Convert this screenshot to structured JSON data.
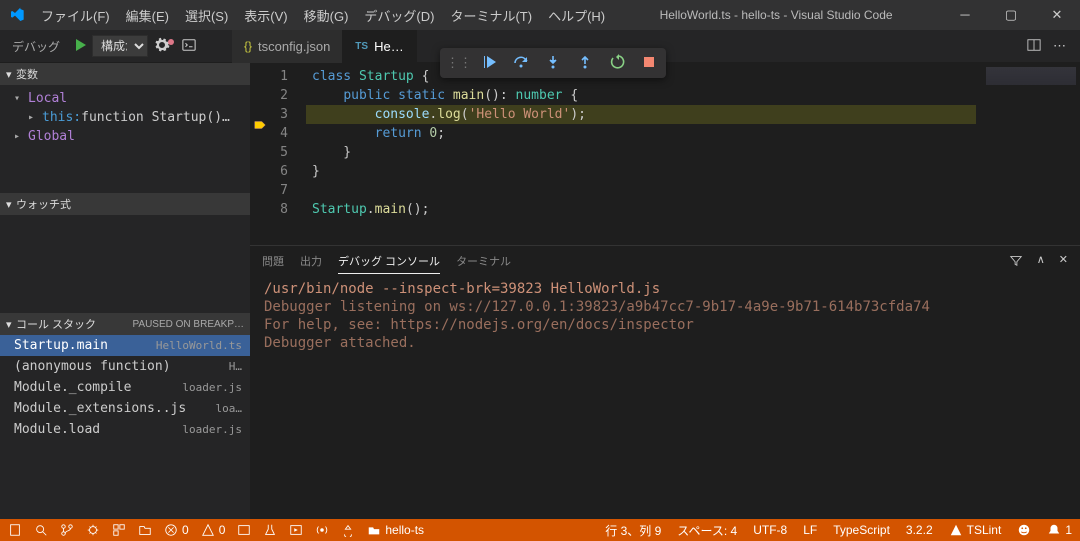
{
  "titlebar": {
    "menu": [
      "ファイル(F)",
      "編集(E)",
      "選択(S)",
      "表示(V)",
      "移動(G)",
      "デバッグ(D)",
      "ターミナル(T)",
      "ヘルプ(H)"
    ],
    "title": "HelloWorld.ts - hello-ts - Visual Studio Code"
  },
  "debugBar": {
    "label": "デバッグ",
    "config": "構成がぁ"
  },
  "tabs": [
    {
      "icon": "br",
      "label": "tsconfig.json",
      "active": false
    },
    {
      "icon": "ts",
      "label": "HelloWorld.ts",
      "active": true
    }
  ],
  "sidebar": {
    "variables": {
      "title": "変数",
      "local": "Local",
      "global": "Global",
      "thisLine1": "this:",
      "thisLine2": " function Startup()…"
    },
    "watch": {
      "title": "ウォッチ式"
    },
    "callstack": {
      "title": "コール スタック",
      "status": "PAUSED ON BREAKP…",
      "frames": [
        {
          "name": "Startup.main",
          "file": "HelloWorld.ts",
          "active": true
        },
        {
          "name": "(anonymous function)",
          "file": "H…",
          "active": false
        },
        {
          "name": "Module._compile",
          "file": "loader.js",
          "active": false
        },
        {
          "name": "Module._extensions..js",
          "file": "loa…",
          "active": false
        },
        {
          "name": "Module.load",
          "file": "loader.js",
          "active": false
        }
      ]
    }
  },
  "editor": {
    "cursorLine": 3,
    "lines": [
      {
        "n": 1,
        "html": "<span class='tok-kw'>class</span> <span class='tok-cls'>Startup</span> {"
      },
      {
        "n": 2,
        "html": "    <span class='tok-kw'>public</span> <span class='tok-kw'>static</span> <span class='tok-fn'>main</span>(): <span class='tok-cls'>number</span> {"
      },
      {
        "n": 3,
        "html": "        <span class='tok-obj'>console</span>.<span class='tok-fn'>log</span>(<span class='tok-str'>'Hello World'</span>);"
      },
      {
        "n": 4,
        "html": "        <span class='tok-kw'>return</span> <span class='tok-num'>0</span>;"
      },
      {
        "n": 5,
        "html": "    }"
      },
      {
        "n": 6,
        "html": "}"
      },
      {
        "n": 7,
        "html": ""
      },
      {
        "n": 8,
        "html": "<span class='tok-cls'>Startup</span>.<span class='tok-fn'>main</span>();"
      }
    ]
  },
  "panel": {
    "tabs": [
      "問題",
      "出力",
      "デバッグ コンソール",
      "ターミナル"
    ],
    "activeTab": "デバッグ コンソール",
    "console": [
      "/usr/bin/node --inspect-brk=39823 HelloWorld.js",
      "Debugger listening on ws://127.0.0.1:39823/a9b47cc7-9b17-4a9e-9b71-614b73cfda74",
      "For help, see: https://nodejs.org/en/docs/inspector",
      "Debugger attached."
    ]
  },
  "breadcrumb": "〉",
  "statusbar": {
    "errors": "0",
    "warnings": "0",
    "folder": "hello-ts",
    "pos": "行 3、列 9",
    "spaces": "スペース: 4",
    "encoding": "UTF-8",
    "eol": "LF",
    "lang": "TypeScript",
    "ver": "3.2.2",
    "tslint": "TSLint",
    "bell": "1"
  }
}
